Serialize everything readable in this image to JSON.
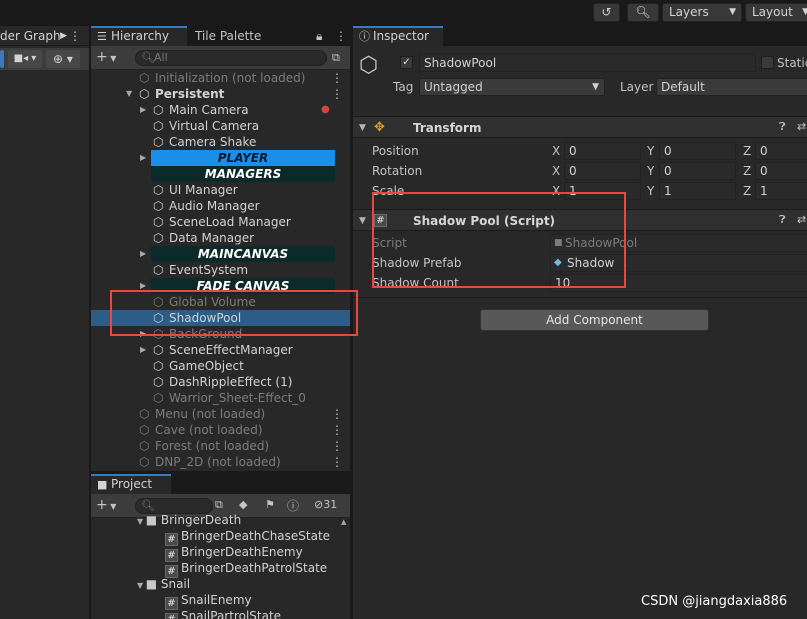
{
  "toolbar": {
    "layers_label": "Layers",
    "layout_label": "Layout"
  },
  "left_panel": {
    "tab_label": "der Graph"
  },
  "hierarchy": {
    "tab_label": "Hierarchy",
    "second_tab_label": "Tile Palette",
    "search_placeholder": "All",
    "rows": [
      {
        "label": "Initialization (not loaded)",
        "depth": 0,
        "kind": "scene",
        "dim": true
      },
      {
        "label": "Persistent",
        "depth": 0,
        "kind": "scene",
        "bold": true,
        "expanded": true
      },
      {
        "label": "Main Camera",
        "depth": 1,
        "kind": "object",
        "expander": true
      },
      {
        "label": "Virtual Camera",
        "depth": 1,
        "kind": "object"
      },
      {
        "label": "Camera Shake",
        "depth": 1,
        "kind": "object"
      },
      {
        "label": "PLAYER",
        "depth": 1,
        "kind": "banner",
        "color": "#1a8ee8",
        "text_color": "#0b1b2b",
        "expander": true
      },
      {
        "label": "MANAGERS",
        "depth": 1,
        "kind": "banner",
        "color": "#0c2a29",
        "text_color": "#ffffff"
      },
      {
        "label": "UI Manager",
        "depth": 1,
        "kind": "object"
      },
      {
        "label": "Audio Manager",
        "depth": 1,
        "kind": "object"
      },
      {
        "label": "SceneLoad Manager",
        "depth": 1,
        "kind": "object"
      },
      {
        "label": "Data Manager",
        "depth": 1,
        "kind": "object"
      },
      {
        "label": "MAINCANVAS",
        "depth": 1,
        "kind": "banner",
        "color": "#0c2a29",
        "text_color": "#ffffff",
        "expander": true
      },
      {
        "label": "EventSystem",
        "depth": 1,
        "kind": "object"
      },
      {
        "label": "FADE CANVAS",
        "depth": 1,
        "kind": "banner",
        "color": "#0c2a29",
        "text_color": "#ffffff",
        "expander": true
      },
      {
        "label": "Global Volume",
        "depth": 1,
        "kind": "object",
        "dim": true
      },
      {
        "label": "ShadowPool",
        "depth": 1,
        "kind": "object",
        "selected": true
      },
      {
        "label": "BackGround",
        "depth": 1,
        "kind": "object",
        "dim": true,
        "expander": true
      },
      {
        "label": "SceneEffectManager",
        "depth": 1,
        "kind": "object",
        "expander": true
      },
      {
        "label": "GameObject",
        "depth": 1,
        "kind": "object"
      },
      {
        "label": "DashRippleEffect (1)",
        "depth": 1,
        "kind": "object"
      },
      {
        "label": "Warrior_Sheet-Effect_0",
        "depth": 1,
        "kind": "object",
        "dim": true
      },
      {
        "label": "Menu (not loaded)",
        "depth": 0,
        "kind": "scene",
        "dim": true
      },
      {
        "label": "Cave (not loaded)",
        "depth": 0,
        "kind": "scene",
        "dim": true
      },
      {
        "label": "Forest (not loaded)",
        "depth": 0,
        "kind": "scene",
        "dim": true
      },
      {
        "label": "DNP_2D (not loaded)",
        "depth": 0,
        "kind": "scene",
        "dim": true
      }
    ]
  },
  "project": {
    "tab_label": "Project",
    "hidden_count": "31",
    "items": [
      {
        "label": "BringerDeath",
        "kind": "folder"
      },
      {
        "label": "BringerDeathChaseState",
        "kind": "script"
      },
      {
        "label": "BringerDeathEnemy",
        "kind": "script"
      },
      {
        "label": "BringerDeathPatrolState",
        "kind": "script"
      },
      {
        "label": "Snail",
        "kind": "folder"
      },
      {
        "label": "SnailEnemy",
        "kind": "script"
      },
      {
        "label": "SnailPartrolState",
        "kind": "script"
      }
    ]
  },
  "inspector": {
    "tab_label": "Inspector",
    "object_name": "ShadowPool",
    "static_label": "Static",
    "tag_label": "Tag",
    "tag_value": "Untagged",
    "layer_label": "Layer",
    "layer_value": "Default",
    "transform": {
      "title": "Transform",
      "rows": [
        {
          "label": "Position",
          "x": "0",
          "y": "0",
          "z": "0"
        },
        {
          "label": "Rotation",
          "x": "0",
          "y": "0",
          "z": "0"
        },
        {
          "label": "Scale",
          "x": "1",
          "y": "1",
          "z": "1"
        }
      ],
      "axis_x": "X",
      "axis_y": "Y",
      "axis_z": "Z"
    },
    "script_component": {
      "title": "Shadow Pool (Script)",
      "script_label": "Script",
      "script_value": "ShadowPool",
      "prefab_label": "Shadow Prefab",
      "prefab_value": "Shadow",
      "count_label": "Shadow Count",
      "count_value": "10"
    },
    "add_component_label": "Add Component"
  },
  "watermark": "CSDN @jiangdaxia886",
  "colors": {
    "highlight": "#e8483f",
    "selection": "#2c5d87",
    "accent": "#3a79bb"
  }
}
